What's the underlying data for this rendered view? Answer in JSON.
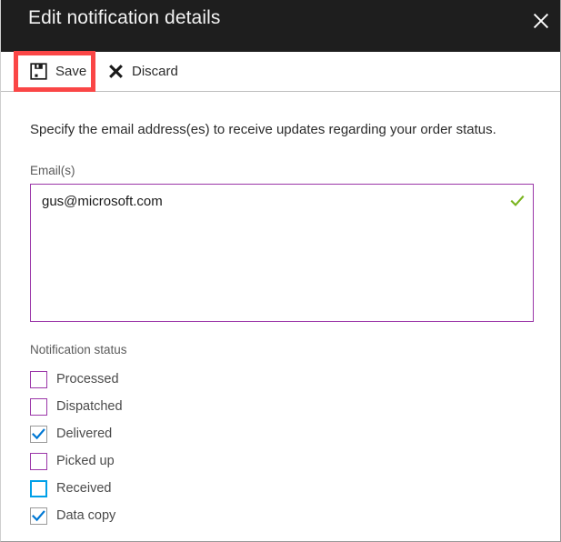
{
  "header": {
    "title": "Edit notification details",
    "close_label": "Close",
    "close_icon": "close-icon",
    "background": "#1e1e1e"
  },
  "toolbar": {
    "save_label": "Save",
    "save_icon": "save-floppy-disk-icon",
    "discard_label": "Discard",
    "discard_icon": "cross-icon",
    "highlight_color": "#fa4646"
  },
  "body": {
    "instruction": "Specify the email address(es) to receive updates regarding your order status.",
    "email_field": {
      "label": "Email(s)",
      "value": "gus@microsoft.com",
      "placeholder": "",
      "border_color": "#9b36a8",
      "valid_icon": "green-checkmark-icon",
      "valid_icon_color": "#79b41e"
    },
    "notification_status": {
      "label": "Notification status",
      "items": [
        {
          "label": "Processed",
          "checked": false,
          "focused": false
        },
        {
          "label": "Dispatched",
          "checked": false,
          "focused": false
        },
        {
          "label": "Delivered",
          "checked": true,
          "focused": false
        },
        {
          "label": "Picked up",
          "checked": false,
          "focused": false
        },
        {
          "label": "Received",
          "checked": false,
          "focused": true
        },
        {
          "label": "Data copy",
          "checked": true,
          "focused": false
        }
      ],
      "unchecked_border": "#9b36a8",
      "checked_border": "#9a9a9a",
      "checkmark_color": "#0078d4",
      "focus_border": "#00a0e8"
    }
  }
}
